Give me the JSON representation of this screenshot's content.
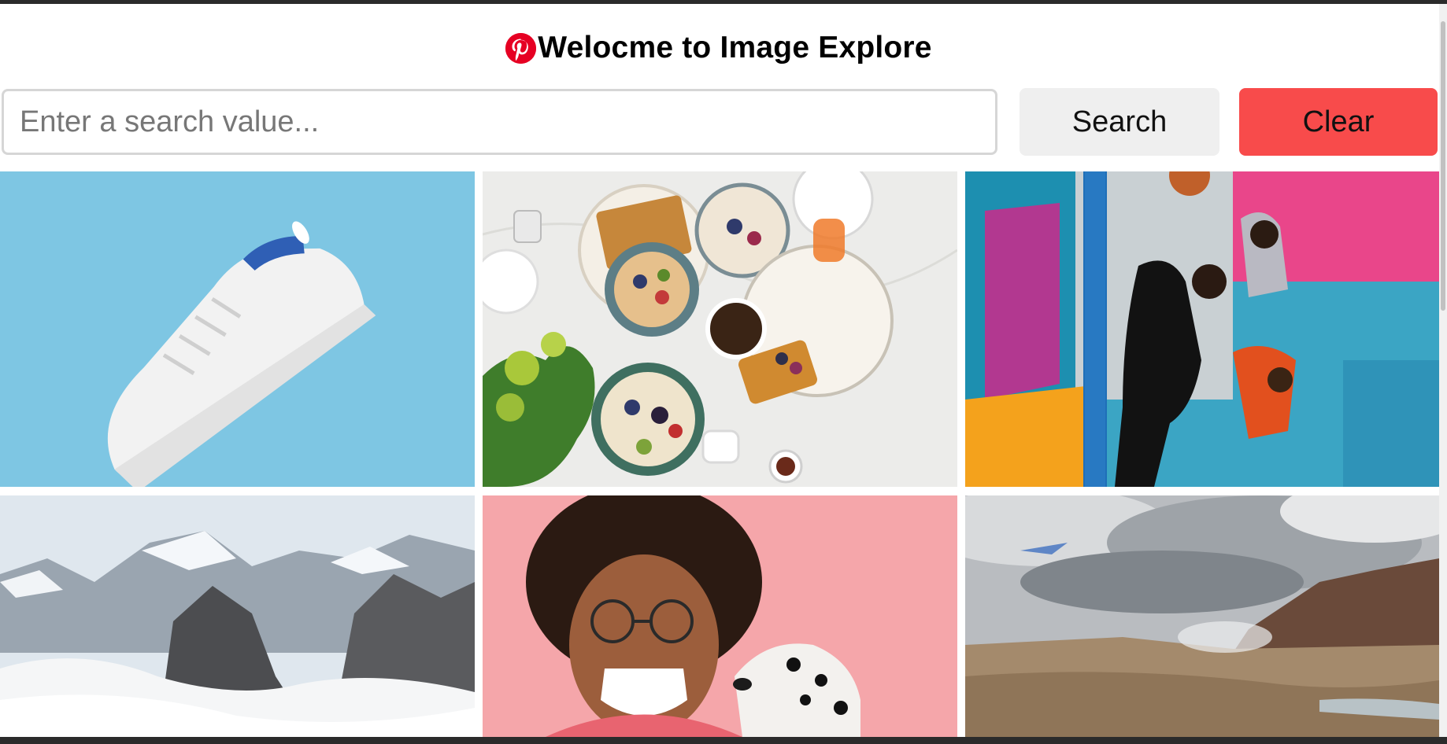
{
  "header": {
    "title": "Welocme to Image Explore",
    "logo_icon": "pinterest-icon"
  },
  "search": {
    "placeholder": "Enter a search value...",
    "value": ""
  },
  "buttons": {
    "search_label": "Search",
    "clear_label": "Clear"
  },
  "colors": {
    "clear_button": "#f84b4b",
    "search_button": "#efefef",
    "logo": "#e60023"
  },
  "gallery": {
    "images": [
      {
        "subject": "white sneaker on blue background"
      },
      {
        "subject": "breakfast bowls and waffles on marble table"
      },
      {
        "subject": "basketball players jumping by colorful wall"
      },
      {
        "subject": "snowy mountain peaks above clouds"
      },
      {
        "subject": "laughing woman with glasses and dalmatian dog"
      },
      {
        "subject": "geothermal landscape with cloudy sky"
      }
    ]
  }
}
